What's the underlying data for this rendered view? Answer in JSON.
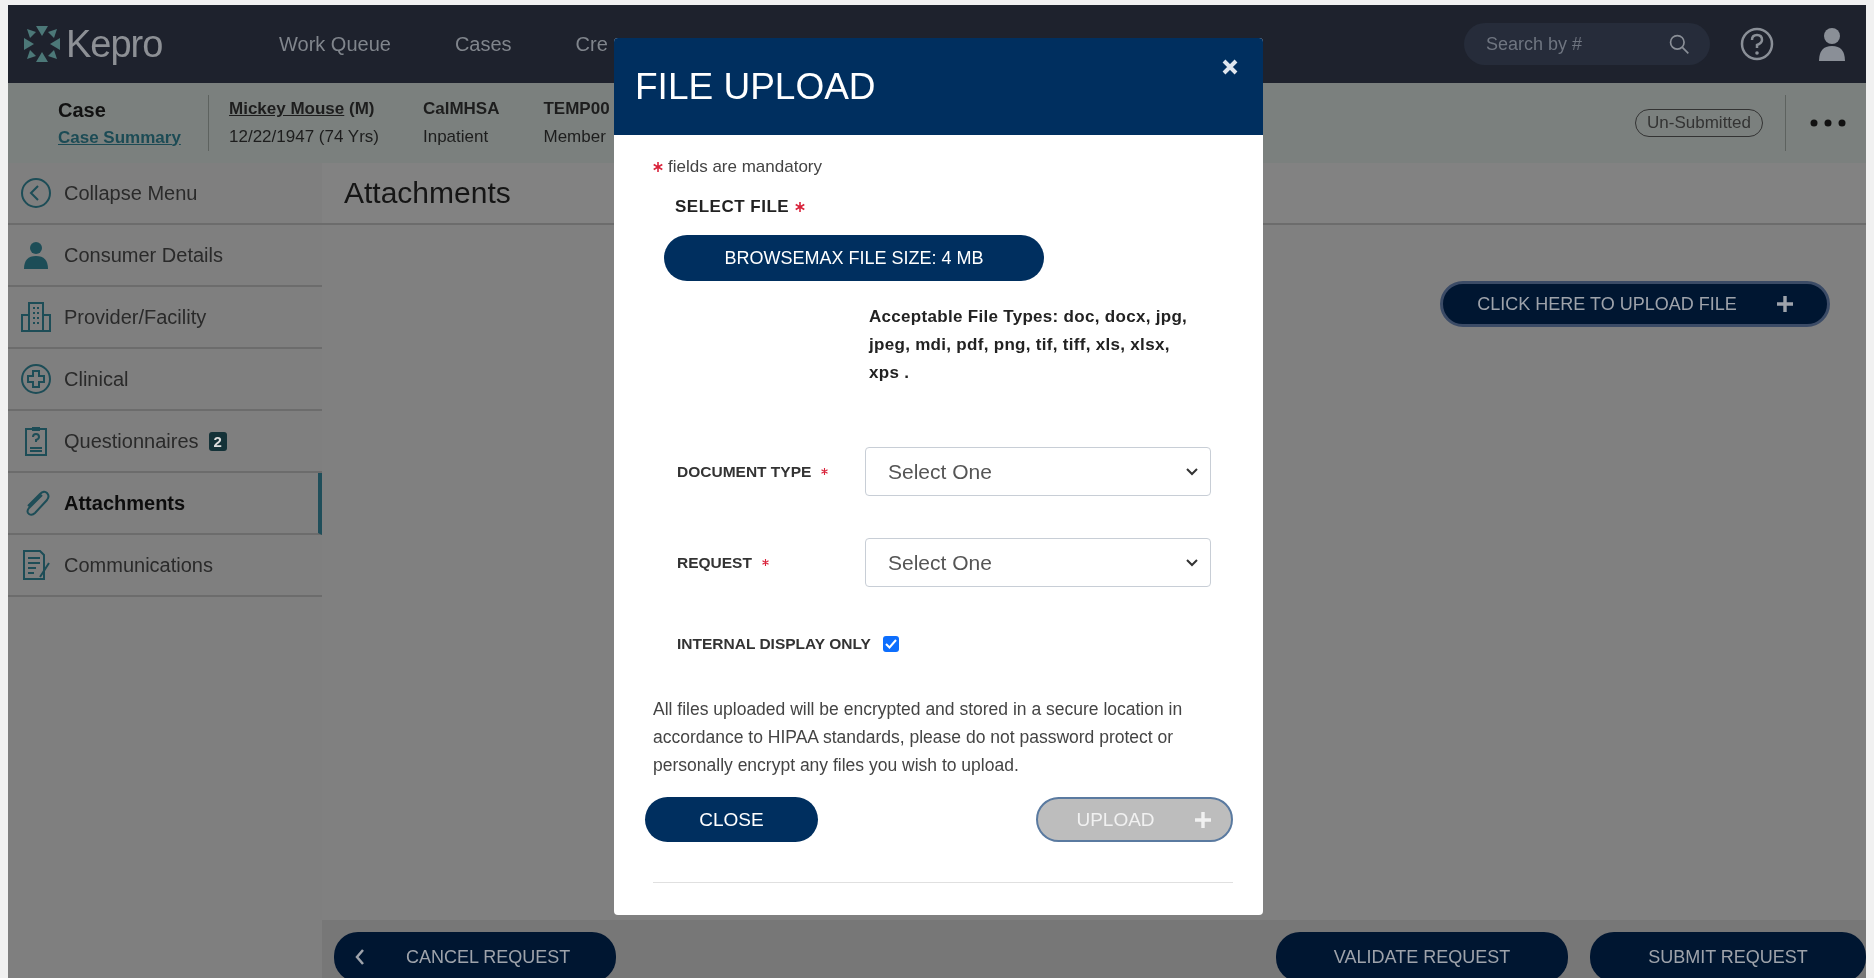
{
  "header": {
    "logo": "Kepro",
    "nav": [
      "Work Queue",
      "Cases",
      "Cre"
    ],
    "search": {
      "placeholder": "Search by #"
    }
  },
  "case_bar": {
    "title": "Case",
    "link": "Case Summary",
    "consumer_name": "Mickey Mouse",
    "consumer_sex": "(M)",
    "consumer_dob": "12/22/1947 (74 Yrs)",
    "plan": "CalMHSA",
    "setting": "Inpatient",
    "member_id": "TEMP00",
    "member_label": "Member",
    "status": "Un-Submitted"
  },
  "sidebar": {
    "items": [
      {
        "label": "Collapse Menu",
        "selected": false
      },
      {
        "label": "Consumer Details",
        "selected": false
      },
      {
        "label": "Provider/Facility",
        "selected": false
      },
      {
        "label": "Clinical",
        "selected": false
      },
      {
        "label": "Questionnaires",
        "selected": false,
        "badge": "2"
      },
      {
        "label": "Attachments",
        "selected": true
      },
      {
        "label": "Communications",
        "selected": false
      }
    ]
  },
  "page": {
    "title": "Attachments",
    "upload_button": "CLICK HERE TO UPLOAD FILE"
  },
  "footer": {
    "cancel_button": "CANCEL REQUEST",
    "validate_button": "VALIDATE REQUEST",
    "submit_button": "SUBMIT REQUEST"
  },
  "modal": {
    "title": "FILE UPLOAD",
    "mandatory_note": "fields are mandatory",
    "select_file_label": "SELECT FILE",
    "browse_button": "BROWSEMAX FILE SIZE: 4 MB",
    "file_types": "Acceptable File Types: doc, docx, jpg, jpeg, mdi, pdf, png, tif, tiff, xls, xlsx, xps .",
    "fields": [
      {
        "label": "DOCUMENT TYPE",
        "required": true,
        "value": "Select One"
      },
      {
        "label": "REQUEST",
        "required": true,
        "value": "Select One"
      }
    ],
    "internal_display": {
      "label": "INTERNAL DISPLAY ONLY",
      "checked": true
    },
    "notice": "All files uploaded will be encrypted and stored in a secure location in accordance to HIPAA standards, please do not password protect or personally encrypt any files you wish to upload.",
    "close_button": "CLOSE",
    "upload_button": {
      "label": "UPLOAD",
      "disabled": true
    }
  }
}
